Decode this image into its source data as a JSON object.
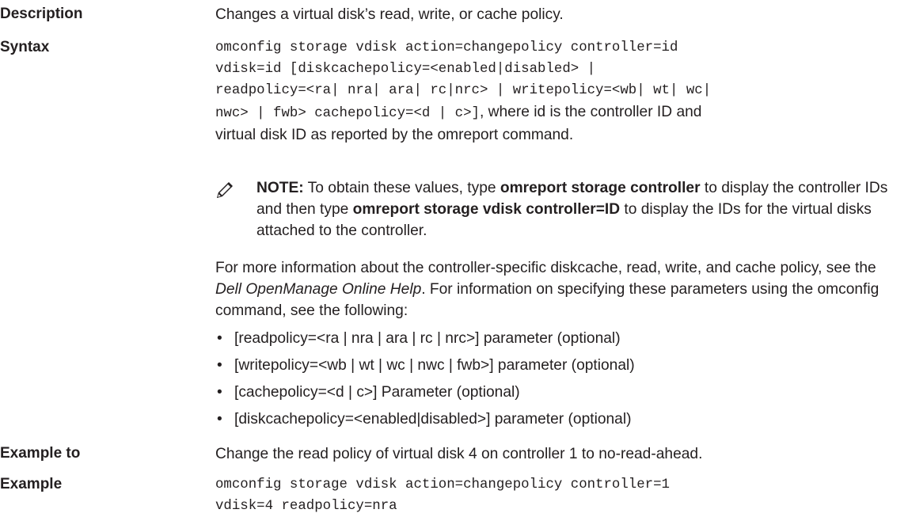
{
  "rows": {
    "description": {
      "label": "Description",
      "text": "Changes a virtual disk’s read, write, or cache policy."
    },
    "syntax": {
      "label": "Syntax",
      "code_lines": [
        "omconfig storage vdisk action=changepolicy controller=id",
        "vdisk=id [diskcachepolicy=<enabled|disabled> |",
        "readpolicy=<ra| nra| ara| rc|nrc> | writepolicy=<wb| wt| wc|",
        "nwc> | fwb> cachepolicy=<d | c>]"
      ],
      "trail_1": ", where id is the controller ID and",
      "trail_2": "virtual disk ID as reported by the omreport command.",
      "note": {
        "icon": "pencil-note-icon",
        "prefix": "NOTE:",
        "t1": " To obtain these values, type ",
        "cmd1": "omreport storage controller",
        "t2": " to display the controller IDs and then type ",
        "cmd2": "omreport storage vdisk controller=ID",
        "t3": " to display the IDs for the virtual disks attached to the controller."
      },
      "more_info": {
        "t1": "For more information about the controller-specific diskcache, read, write, and cache policy, see the ",
        "italic": "Dell OpenManage Online Help",
        "t2": ". For information on specifying these parameters using the omconfig command, see the following:"
      },
      "bullets": [
        "[readpolicy=<ra | nra | ara | rc | nrc>] parameter (optional)",
        "[writepolicy=<wb | wt | wc | nwc | fwb>] parameter (optional)",
        "[cachepolicy=<d | c>] Parameter (optional)",
        "[diskcachepolicy=<enabled|disabled>] parameter (optional)"
      ]
    },
    "example_to": {
      "label": "Example to",
      "text": "Change the read policy of virtual disk 4 on controller 1 to no-read-ahead."
    },
    "example": {
      "label": "Example",
      "code_lines": [
        "omconfig storage vdisk action=changepolicy controller=1",
        "vdisk=4 readpolicy=nra"
      ]
    }
  },
  "colors": {
    "text": "#231f20",
    "icon": "#231f20"
  }
}
